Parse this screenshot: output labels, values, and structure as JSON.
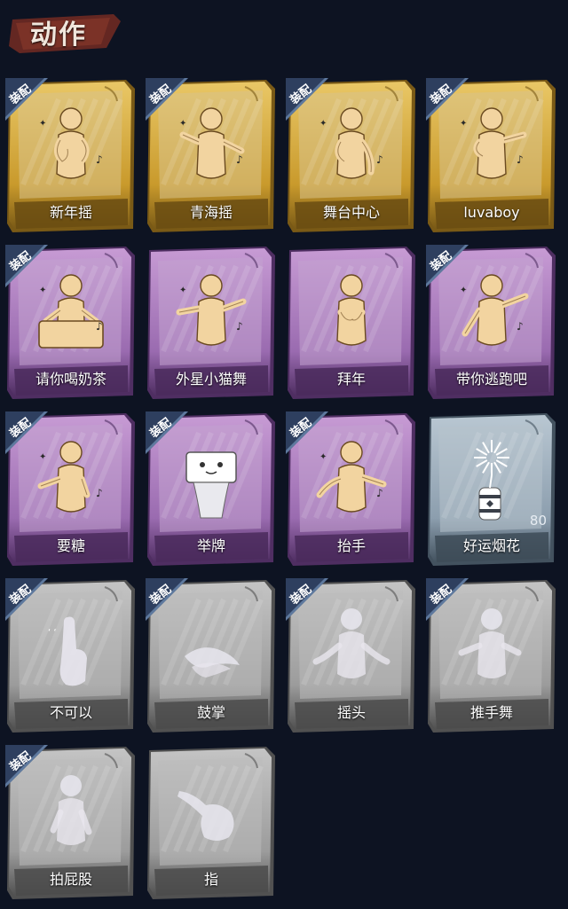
{
  "header": {
    "title": "动作"
  },
  "badge_label": "装配",
  "colors": {
    "gold": "#d4ac3c",
    "purple": "#a77ab8",
    "silver_blue": "#9aa9b5",
    "grey": "#a9a9a9",
    "background": "#0d1322",
    "badge": "#2e3f5f"
  },
  "cards": [
    {
      "label": "新年摇",
      "rarity": "gold",
      "equipped": true,
      "icon": "figure-shake-icon"
    },
    {
      "label": "青海摇",
      "rarity": "gold",
      "equipped": true,
      "icon": "figure-dance-icon"
    },
    {
      "label": "舞台中心",
      "rarity": "gold",
      "equipped": true,
      "icon": "figure-stage-icon"
    },
    {
      "label": "luvaboy",
      "rarity": "gold",
      "equipped": true,
      "icon": "figure-pose-icon"
    },
    {
      "label": "请你喝奶茶",
      "rarity": "purple",
      "equipped": true,
      "icon": "figure-sign-icon"
    },
    {
      "label": "外星小猫舞",
      "rarity": "purple",
      "equipped": false,
      "icon": "figure-cat-dance-icon"
    },
    {
      "label": "拜年",
      "rarity": "purple",
      "equipped": false,
      "icon": "figure-bow-icon"
    },
    {
      "label": "带你逃跑吧",
      "rarity": "purple",
      "equipped": true,
      "icon": "figure-point-icon"
    },
    {
      "label": "要糖",
      "rarity": "purple",
      "equipped": true,
      "icon": "figure-beg-icon"
    },
    {
      "label": "举牌",
      "rarity": "purple",
      "equipped": true,
      "icon": "figure-hold-sign-icon"
    },
    {
      "label": "抬手",
      "rarity": "purple",
      "equipped": true,
      "icon": "figure-raise-hand-icon"
    },
    {
      "label": "好运烟花",
      "rarity": "silver_blue",
      "equipped": false,
      "icon": "firework-icon",
      "count": "80"
    },
    {
      "label": "不可以",
      "rarity": "grey",
      "equipped": true,
      "icon": "finger-wag-icon"
    },
    {
      "label": "鼓掌",
      "rarity": "grey",
      "equipped": true,
      "icon": "clap-icon"
    },
    {
      "label": "摇头",
      "rarity": "grey",
      "equipped": true,
      "icon": "figure-head-shake-icon"
    },
    {
      "label": "推手舞",
      "rarity": "grey",
      "equipped": true,
      "icon": "figure-push-dance-icon"
    },
    {
      "label": "拍屁股",
      "rarity": "grey",
      "equipped": true,
      "icon": "figure-slap-icon"
    },
    {
      "label": "指",
      "rarity": "grey",
      "equipped": false,
      "icon": "pointing-hand-icon"
    }
  ]
}
